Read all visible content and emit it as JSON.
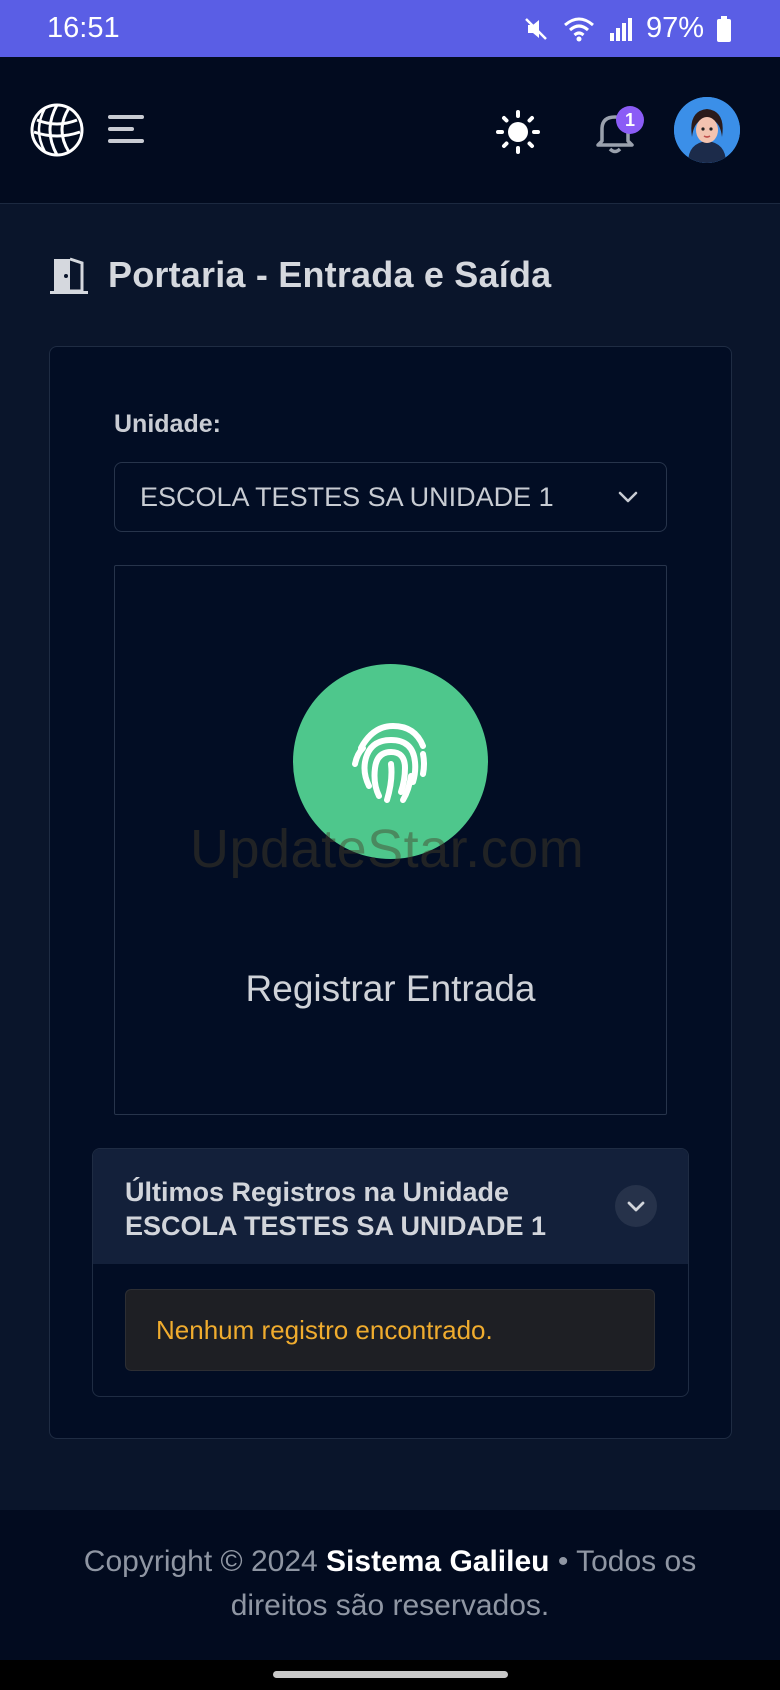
{
  "status_bar": {
    "time": "16:51",
    "battery": "97%"
  },
  "header": {
    "logo_icon": "globe-icon",
    "menu_icon": "hamburger-menu-icon",
    "theme_icon": "sun-icon",
    "notifications_icon": "bell-icon",
    "notification_count": "1",
    "avatar_icon": "user-avatar"
  },
  "page": {
    "title_icon": "door-open-icon",
    "title": "Portaria - Entrada e Saída"
  },
  "unit": {
    "label": "Unidade:",
    "selected": "ESCOLA TESTES SA UNIDADE 1"
  },
  "register": {
    "icon": "fingerprint-icon",
    "label": "Registrar Entrada",
    "watermark": "UpdateStar.com"
  },
  "recent": {
    "title": "Últimos Registros na Unidade ESCOLA TESTES SA UNIDADE 1",
    "empty_message": "Nenhum registro encontrado."
  },
  "footer": {
    "prefix": "Copyright © 2024",
    "brand": "Sistema Galileu",
    "suffix": "• Todos os direitos são reservados."
  },
  "colors": {
    "status_bar": "#5a5ee5",
    "background": "#0a152b",
    "accent_green": "#4ec78c",
    "badge": "#8b5cf6",
    "warning_text": "#f0ac2e"
  }
}
